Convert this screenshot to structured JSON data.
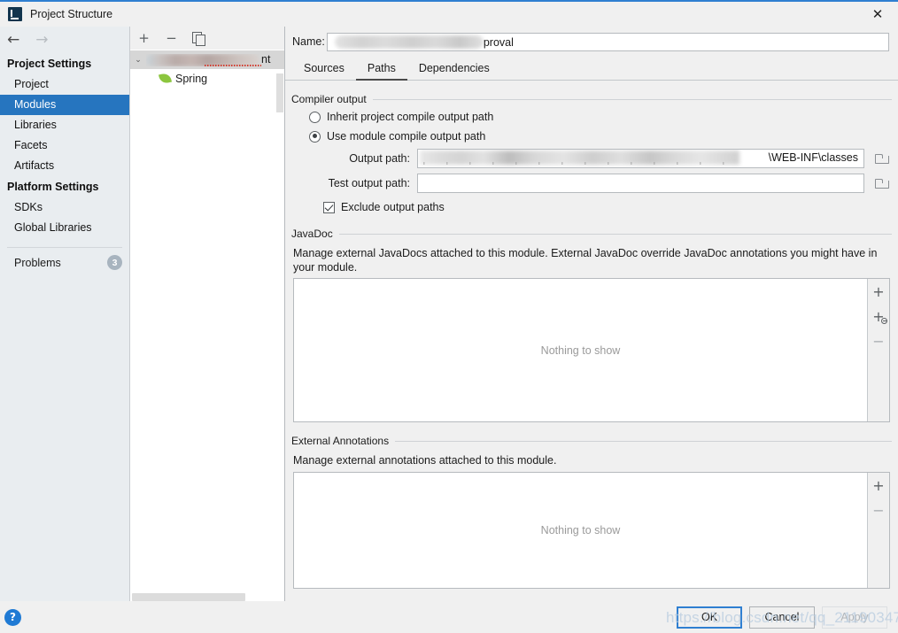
{
  "window": {
    "title": "Project Structure",
    "app_icon": "intellij-idea-icon",
    "close_label": "✕"
  },
  "sidebar": {
    "nav": {
      "back_icon": "arrow-left-icon",
      "back_glyph": "←",
      "forward_icon": "arrow-right-icon",
      "forward_glyph": "→"
    },
    "groups": [
      {
        "title": "Project Settings",
        "items": [
          {
            "label": "Project",
            "selected": false
          },
          {
            "label": "Modules",
            "selected": true
          },
          {
            "label": "Libraries",
            "selected": false
          },
          {
            "label": "Facets",
            "selected": false
          },
          {
            "label": "Artifacts",
            "selected": false
          }
        ]
      },
      {
        "title": "Platform Settings",
        "items": [
          {
            "label": "SDKs",
            "selected": false
          },
          {
            "label": "Global Libraries",
            "selected": false
          }
        ]
      }
    ],
    "problems": {
      "label": "Problems",
      "count": "3"
    }
  },
  "tree": {
    "toolbar": {
      "add_glyph": "+",
      "remove_glyph": "−",
      "copy_icon": "copy-icon"
    },
    "root": {
      "twisty_glyph": "⌄",
      "name_redacted": true,
      "name_tail": "nt",
      "has_error_underline": true
    },
    "children": [
      {
        "label": "Spring",
        "icon": "spring-leaf-icon"
      }
    ]
  },
  "detail": {
    "name": {
      "label": "Name:",
      "value_redacted": true,
      "value_tail": "proval"
    },
    "tabs": [
      {
        "label": "Sources",
        "active": false
      },
      {
        "label": "Paths",
        "active": true
      },
      {
        "label": "Dependencies",
        "active": false
      }
    ],
    "compiler_output": {
      "title": "Compiler output",
      "options": [
        {
          "label": "Inherit project compile output path",
          "checked": false
        },
        {
          "label": "Use module compile output path",
          "checked": true
        }
      ],
      "output_path": {
        "label": "Output path:",
        "value_redacted": true,
        "value_tail": "\\WEB-INF\\classes",
        "browse_icon": "folder-icon"
      },
      "test_output_path": {
        "label": "Test output path:",
        "value": "",
        "browse_icon": "folder-icon"
      },
      "exclude": {
        "label": "Exclude output paths",
        "checked": true
      }
    },
    "javadoc": {
      "title": "JavaDoc",
      "description": "Manage external JavaDocs attached to this module. External JavaDoc override JavaDoc annotations you might have in your module.",
      "empty_text": "Nothing to show",
      "actions": [
        {
          "name": "add-javadoc-button",
          "glyph": "+",
          "disabled": false
        },
        {
          "name": "specify-javadoc-url-button",
          "glyph": "+",
          "disabled": false
        },
        {
          "name": "remove-javadoc-button",
          "glyph": "−",
          "disabled": true
        }
      ]
    },
    "annotations": {
      "title": "External Annotations",
      "description": "Manage external annotations attached to this module.",
      "empty_text": "Nothing to show",
      "actions": [
        {
          "name": "add-annotation-button",
          "glyph": "+",
          "disabled": false
        },
        {
          "name": "remove-annotation-button",
          "glyph": "−",
          "disabled": true
        }
      ]
    }
  },
  "footer": {
    "help_glyph": "?",
    "ok_label": "OK",
    "cancel_label": "Cancel",
    "apply_label": "Apply"
  },
  "watermark": {
    "text": "https://blog.csdn.net/qq_21190347"
  },
  "colors": {
    "accent": "#2675bf",
    "window_border": "#2f7fd1",
    "sidebar_bg": "#e9edf0",
    "panel_bg": "#f0f0f0",
    "badge_bg": "#a8b4bf",
    "help_blue": "#1f7ad4",
    "spring_green": "#8cc63f",
    "error_red": "#d23b2e"
  }
}
